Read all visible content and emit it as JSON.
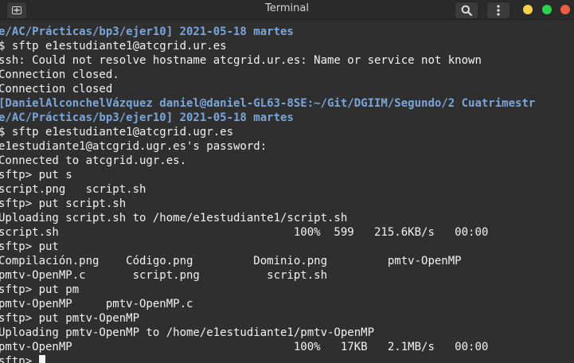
{
  "window": {
    "title": "Terminal",
    "icons": {
      "new_tab": "new-tab-icon",
      "search": "search-icon",
      "menu": "menu-dots-icon"
    },
    "controls": {
      "minimize_color": "#f6d04a",
      "maximize_color": "#2bd14b",
      "close_color": "#ee5d41"
    },
    "accent": "#7aa6da",
    "text_color": "#f2f2f2"
  },
  "terminal": {
    "lines": [
      {
        "text": "e/AC/Prácticas/bp3/ejer10] 2021-05-18 martes",
        "kind": "prompt"
      },
      {
        "text": "$ sftp e1estudiante1@atcgrid.ur.es",
        "kind": "normal"
      },
      {
        "text": "ssh: Could not resolve hostname atcgrid.ur.es: Name or service not known",
        "kind": "normal"
      },
      {
        "text": "Connection closed.",
        "kind": "normal"
      },
      {
        "text": "Connection closed",
        "kind": "normal"
      },
      {
        "text": "[DanielAlconchelVázquez daniel@daniel-GL63-8SE:~/Git/DGIIM/Segundo/2 Cuatrimestr",
        "kind": "prompt"
      },
      {
        "text": "e/AC/Prácticas/bp3/ejer10] 2021-05-18 martes",
        "kind": "prompt"
      },
      {
        "text": "$ sftp e1estudiante1@atcgrid.ugr.es",
        "kind": "normal"
      },
      {
        "text": "e1estudiante1@atcgrid.ugr.es's password:",
        "kind": "normal"
      },
      {
        "text": "Connected to atcgrid.ugr.es.",
        "kind": "normal"
      },
      {
        "text": "sftp> put s",
        "kind": "normal"
      },
      {
        "text": "script.png   script.sh",
        "kind": "normal"
      },
      {
        "text": "sftp> put script.sh",
        "kind": "normal"
      },
      {
        "text": "Uploading script.sh to /home/e1estudiante1/script.sh",
        "kind": "normal"
      },
      {
        "text": "script.sh                                   100%  599   215.6KB/s   00:00",
        "kind": "normal"
      },
      {
        "text": "sftp> put",
        "kind": "normal"
      },
      {
        "text": "Compilación.png    Código.png         Dominio.png         pmtv-OpenMP",
        "kind": "normal"
      },
      {
        "text": "pmtv-OpenMP.c       script.png          script.sh",
        "kind": "normal"
      },
      {
        "text": "sftp> put pm",
        "kind": "normal"
      },
      {
        "text": "pmtv-OpenMP     pmtv-OpenMP.c",
        "kind": "normal"
      },
      {
        "text": "sftp> put pmtv-OpenMP",
        "kind": "normal"
      },
      {
        "text": "Uploading pmtv-OpenMP to /home/e1estudiante1/pmtv-OpenMP",
        "kind": "normal"
      },
      {
        "text": "pmtv-OpenMP                                 100%   17KB   2.1MB/s   00:00",
        "kind": "normal"
      }
    ],
    "current_prompt": "sftp> "
  }
}
